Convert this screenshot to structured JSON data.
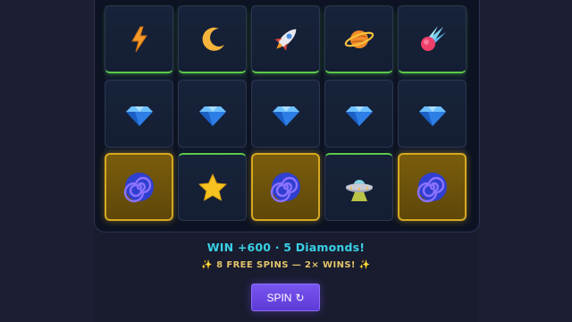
{
  "reels": [
    {
      "symbols": [
        "lightning",
        "diamond",
        "spiral"
      ],
      "highlight_bottom": true
    },
    {
      "symbols": [
        "moon",
        "diamond",
        "star"
      ],
      "highlight_bottom": false
    },
    {
      "symbols": [
        "rocket",
        "diamond",
        "spiral"
      ],
      "highlight_bottom": true
    },
    {
      "symbols": [
        "planet",
        "diamond",
        "ufo"
      ],
      "highlight_bottom": false
    },
    {
      "symbols": [
        "comet",
        "diamond",
        "spiral"
      ],
      "highlight_bottom": true
    }
  ],
  "result": {
    "win_text": "WIN +600 · 5 Diamonds!",
    "free_spins_text": "8 FREE SPINS — 2× WINS!",
    "sparkle_left": "✨",
    "sparkle_right": "✨"
  },
  "spin_button": {
    "label": "SPIN",
    "icon": "↻"
  },
  "colors": {
    "win_line": "#5cc94a",
    "highlight": "#d6a820",
    "win_text": "#39d0e6",
    "free_spins_text": "#e2c56a",
    "spin_button": "#6a48e4"
  }
}
